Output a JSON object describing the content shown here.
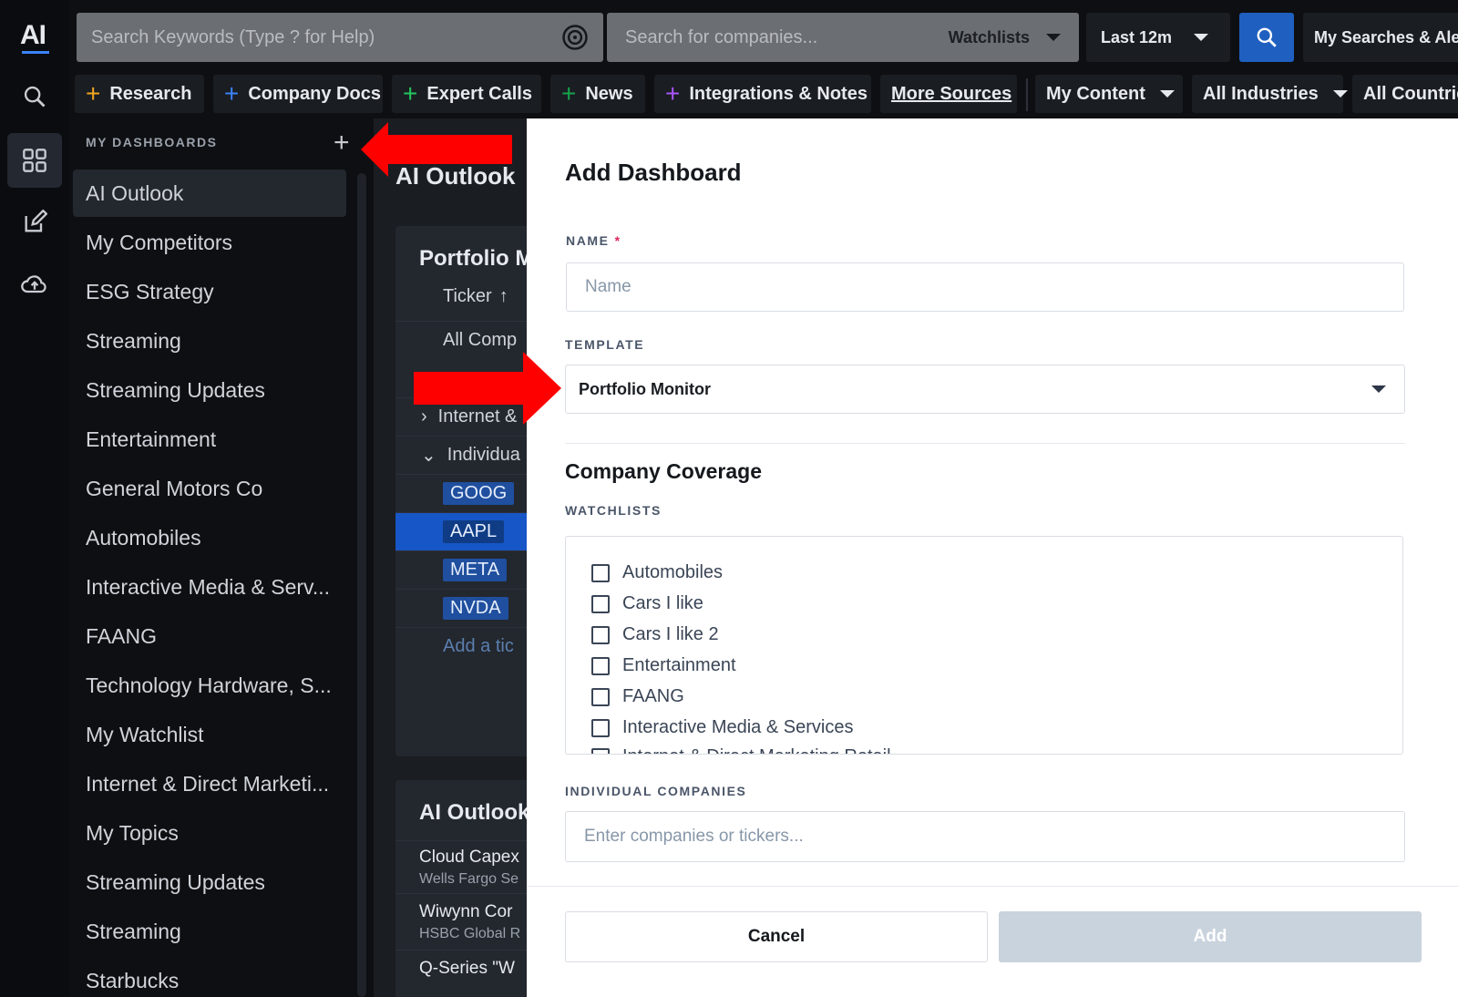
{
  "logo": "AI",
  "topbar": {
    "keyword_search_placeholder": "Search Keywords (Type ? for Help)",
    "company_search_placeholder": "Search for companies...",
    "watchlists_label": "Watchlists",
    "period_label": "Last 12m",
    "my_searches_label": "My Searches & Alerts"
  },
  "nav": {
    "research": "Research",
    "company_docs": "Company Docs",
    "expert_calls": "Expert Calls",
    "news": "News",
    "integrations": "Integrations & Notes",
    "more_sources": "More Sources",
    "my_content": "My Content",
    "all_industries": "All Industries",
    "all_countries": "All Countries"
  },
  "sidebar": {
    "heading": "MY DASHBOARDS",
    "items": [
      "AI Outlook",
      "My Competitors",
      "ESG Strategy",
      "Streaming",
      "Streaming Updates",
      "Entertainment",
      "General Motors Co",
      "Automobiles",
      "Interactive Media & Serv...",
      "FAANG",
      "Technology Hardware, S...",
      "My Watchlist",
      "Internet & Direct Marketi...",
      "My Topics",
      "Streaming Updates",
      "Streaming",
      "Starbucks"
    ]
  },
  "main": {
    "title": "AI Outlook",
    "card1": {
      "heading": "Portfolio M",
      "ticker_col": "Ticker",
      "all_companies": "All Comp",
      "internet": "Internet &",
      "individual": "Individua",
      "tickers": [
        "GOOG",
        "AAPL",
        "META",
        "NVDA"
      ],
      "add_ticker": "Add a tic"
    },
    "card2": {
      "heading": "AI Outlook",
      "items": [
        {
          "title": "Cloud Capex",
          "source": "Wells Fargo Se"
        },
        {
          "title": "Wiwynn Cor",
          "source": "HSBC Global R"
        },
        {
          "title": "Q-Series \"W",
          "source": ""
        }
      ]
    }
  },
  "modal": {
    "title": "Add Dashboard",
    "name_label": "NAME",
    "name_required": "*",
    "name_placeholder": "Name",
    "template_label": "TEMPLATE",
    "template_value": "Portfolio Monitor",
    "coverage_heading": "Company Coverage",
    "watchlists_label": "WATCHLISTS",
    "watchlists": [
      "Automobiles",
      "Cars I like",
      "Cars I like 2",
      "Entertainment",
      "FAANG",
      "Interactive Media & Services",
      "Internet & Direct Marketing Retail"
    ],
    "individual_label": "INDIVIDUAL COMPANIES",
    "individual_placeholder": "Enter companies or tickers...",
    "cancel_label": "Cancel",
    "add_label": "Add"
  },
  "colors": {
    "accent": "#1f5fbf",
    "annotation_arrow": "#ff0000",
    "add_disabled": "#c9d3dd"
  }
}
